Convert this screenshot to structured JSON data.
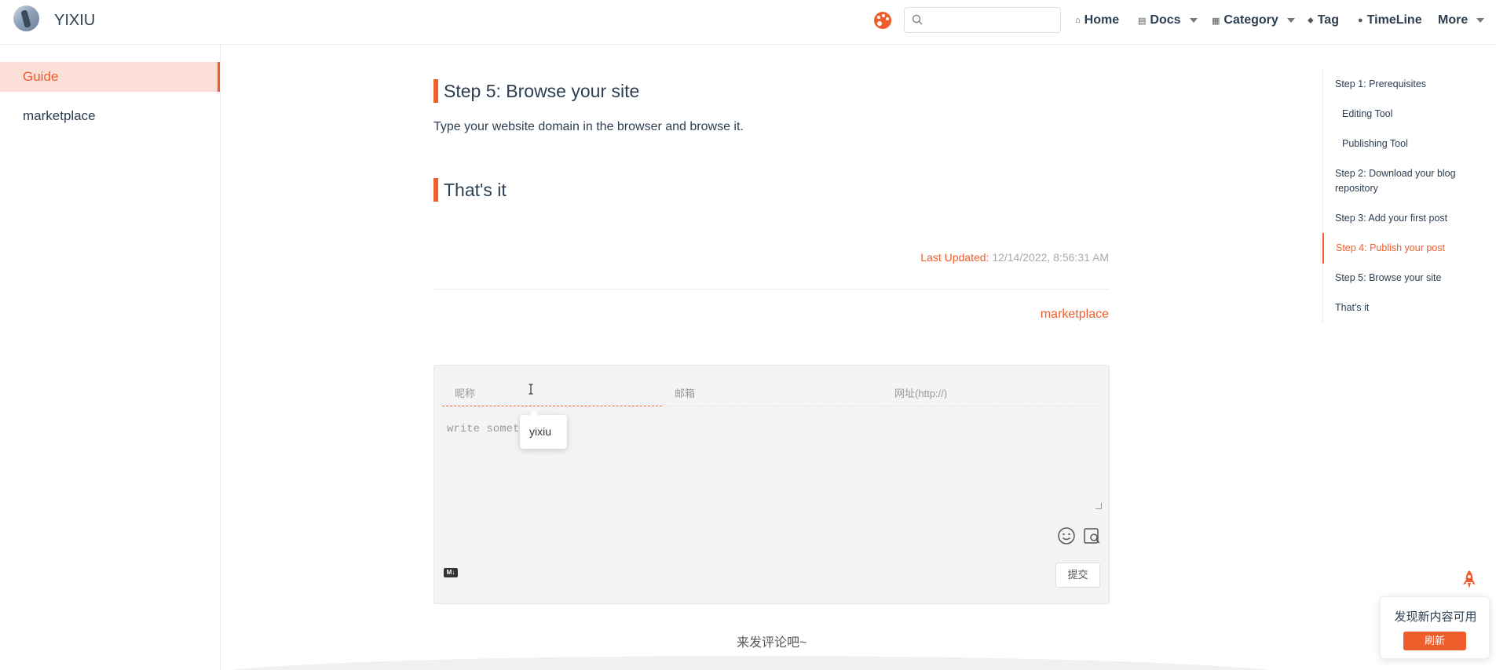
{
  "navbar": {
    "site_name": "YIXIU",
    "search_placeholder": "",
    "items": [
      {
        "label": "Home",
        "icon": "home-icon"
      },
      {
        "label": "Docs",
        "icon": "docs-icon"
      },
      {
        "label": "Category",
        "icon": "category-icon"
      },
      {
        "label": "Tag",
        "icon": "tag-icon"
      },
      {
        "label": "TimeLine",
        "icon": "clock-icon"
      },
      {
        "label": "More",
        "icon": ""
      }
    ]
  },
  "sidebar": {
    "items": [
      {
        "label": "Guide",
        "active": true
      },
      {
        "label": "marketplace",
        "active": false
      }
    ]
  },
  "content": {
    "step5_heading": "Step 5: Browse your site",
    "step5_text": "Type your website domain in the browser and browse it.",
    "thats_it_heading": "That's it",
    "last_updated_label": "Last Updated:",
    "last_updated_value": "12/14/2022, 8:56:31 AM",
    "next_link": "marketplace"
  },
  "comments": {
    "nick_placeholder": "昵称",
    "mail_placeholder": "邮箱",
    "link_placeholder": "网址(http://)",
    "textarea_placeholder": "write somet",
    "autocomplete_value": "yixiu",
    "md_label": "M↓",
    "submit_label": "提交",
    "empty_text": "来发评论吧~"
  },
  "toc": {
    "items": [
      {
        "label": "Step 1: Prerequisites",
        "level": 1
      },
      {
        "label": "Editing Tool",
        "level": 2
      },
      {
        "label": "Publishing Tool",
        "level": 2
      },
      {
        "label": "Step 2: Download your blog repository",
        "level": 1
      },
      {
        "label": "Step 3: Add your first post",
        "level": 1
      },
      {
        "label": "Step 4: Publish your post",
        "level": 1,
        "active": true
      },
      {
        "label": "Step 5: Browse your site",
        "level": 1
      },
      {
        "label": "That's it",
        "level": 1
      }
    ]
  },
  "update_popup": {
    "text": "发现新内容可用",
    "button": "刷新"
  },
  "colors": {
    "accent": "#ee5d2b"
  }
}
